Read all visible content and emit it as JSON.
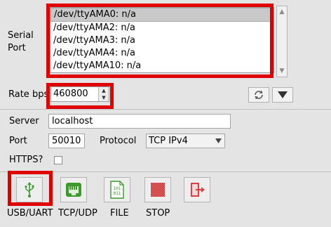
{
  "serial": {
    "label": "Serial\nPort",
    "ports": [
      "/dev/ttyAMA0: n/a",
      "/dev/ttyAMA2: n/a",
      "/dev/ttyAMA3: n/a",
      "/dev/ttyAMA4: n/a",
      "/dev/ttyAMA10: n/a"
    ],
    "selected_index": 0
  },
  "rate": {
    "label": "Rate bps",
    "value": "460800"
  },
  "network": {
    "server_label": "Server",
    "server_value": "localhost",
    "port_label": "Port",
    "port_value": "50010",
    "protocol_label": "Protocol",
    "protocol_value": "TCP IPv4",
    "https_label": "HTTPS?",
    "https_checked": false
  },
  "modes": {
    "usb_label": "USB/UART",
    "tcp_label": "TCP/UDP",
    "file_label": "FILE",
    "stop_label": "STOP",
    "file_icon_text": "101\n011"
  },
  "icons": {
    "refresh": "refresh-icon",
    "dropdown": "chevron-down-icon",
    "usb": "usb-icon",
    "tcp": "ethernet-icon",
    "file": "binary-file-icon",
    "stop": "stop-icon",
    "exit": "exit-icon"
  },
  "colors": {
    "highlight": "#e00000",
    "usb_green": "#3a9a2a",
    "stop_red": "#d03030",
    "exit_red": "#e04040"
  }
}
